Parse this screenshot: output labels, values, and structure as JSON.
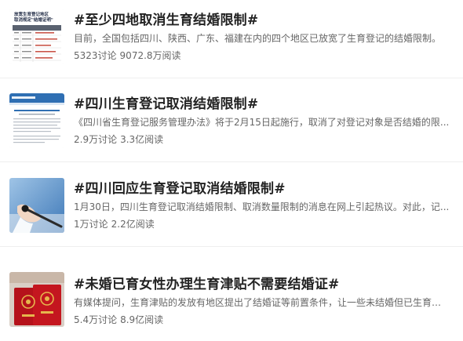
{
  "topics": [
    {
      "title": "#至少四地取消生育结婚限制#",
      "summary": "目前，全国包括四川、陕西、广东、福建在内的四个地区已放宽了生育登记的结婚限制。",
      "discussions": "5323讨论",
      "views": "9072.8万阅读",
      "thumb_icon": "table-document-icon",
      "thumb_text": [
        "放宽生育登记地区",
        "取消规定\"结婚证明\""
      ]
    },
    {
      "title": "#四川生育登记取消结婚限制#",
      "summary": "《四川省生育登记服务管理办法》将于2月15日起施行，取消了对登记对象是否结婚的限...",
      "discussions": "2.9万讨论",
      "views": "3.3亿阅读",
      "thumb_icon": "government-webpage-icon"
    },
    {
      "title": "#四川回应生育登记取消结婚限制#",
      "summary": "1月30日，四川生育登记取消结婚限制、取消数量限制的消息在网上引起热议。对此，记...",
      "discussions": "1万讨论",
      "views": "2.2亿阅读",
      "thumb_icon": "microphone-icon"
    },
    {
      "title": "#未婚已育女性办理生育津贴不需要结婚证#",
      "summary": "有媒体提问，生育津贴的发放有地区提出了结婚证等前置条件，让一些未结婚但已生育的女...",
      "discussions": "5.4万讨论",
      "views": "8.9亿阅读",
      "thumb_icon": "marriage-certificate-icon"
    }
  ],
  "colors": {
    "title": "#222222",
    "meta": "#666666",
    "divider": "#eeeeee",
    "certificate_red": "#b5121b"
  }
}
